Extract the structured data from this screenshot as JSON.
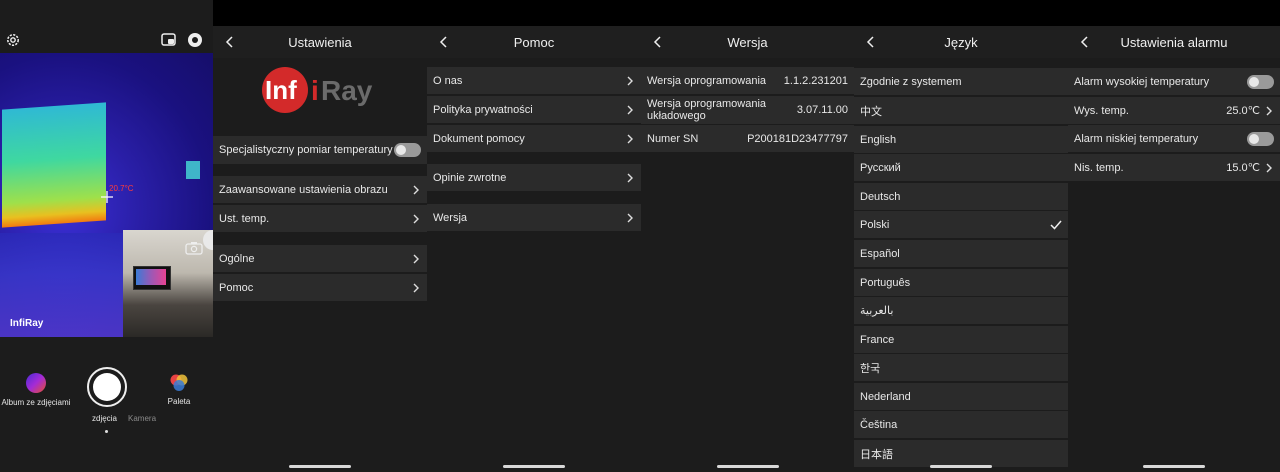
{
  "camera": {
    "temp_reading": "20.7°C",
    "brand": "InfiRay",
    "album_label": "Album ze zdjęciami",
    "mode_photo": "zdjęcia",
    "mode_video": "Kamera",
    "palette_label": "Paleta"
  },
  "settings": {
    "title": "Ustawienia",
    "logo_text": "InfiRay",
    "items": [
      {
        "label": "Specjalistyczny pomiar temperatury",
        "control": "toggle",
        "state": "off"
      },
      {
        "label": "Zaawansowane ustawienia obrazu",
        "control": "chevron"
      },
      {
        "label": "Ust. temp.",
        "control": "chevron"
      },
      {
        "label": "Ogólne",
        "control": "chevron"
      },
      {
        "label": "Pomoc",
        "control": "chevron"
      }
    ]
  },
  "help": {
    "title": "Pomoc",
    "items": [
      {
        "label": "O nas"
      },
      {
        "label": "Polityka prywatności"
      },
      {
        "label": "Dokument pomocy"
      },
      {
        "label": "Opinie zwrotne"
      },
      {
        "label": "Wersja"
      }
    ]
  },
  "version": {
    "title": "Wersja",
    "items": [
      {
        "label": "Wersja oprogramowania",
        "value": "1.1.2.231201"
      },
      {
        "label": "Wersja oprogramowania układowego",
        "value": "3.07.11.00"
      },
      {
        "label": "Numer SN",
        "value": "P200181D23477797"
      }
    ]
  },
  "language": {
    "title": "Język",
    "selected": "Polski",
    "items": [
      "Zgodnie z systemem",
      "中文",
      "English",
      "Русский",
      "Deutsch",
      "Polski",
      "Español",
      "Português",
      "بالعربية",
      "France",
      "한국",
      "Nederland",
      "Čeština",
      "日本語"
    ]
  },
  "alarm": {
    "title": "Ustawienia alarmu",
    "items": [
      {
        "label": "Alarm wysokiej temperatury",
        "control": "toggle",
        "state": "off"
      },
      {
        "label": "Wys. temp.",
        "value": "25.0℃",
        "control": "chevron"
      },
      {
        "label": "Alarm niskiej temperatury",
        "control": "toggle",
        "state": "off"
      },
      {
        "label": "Nis. temp.",
        "value": "15.0℃",
        "control": "chevron"
      }
    ]
  }
}
